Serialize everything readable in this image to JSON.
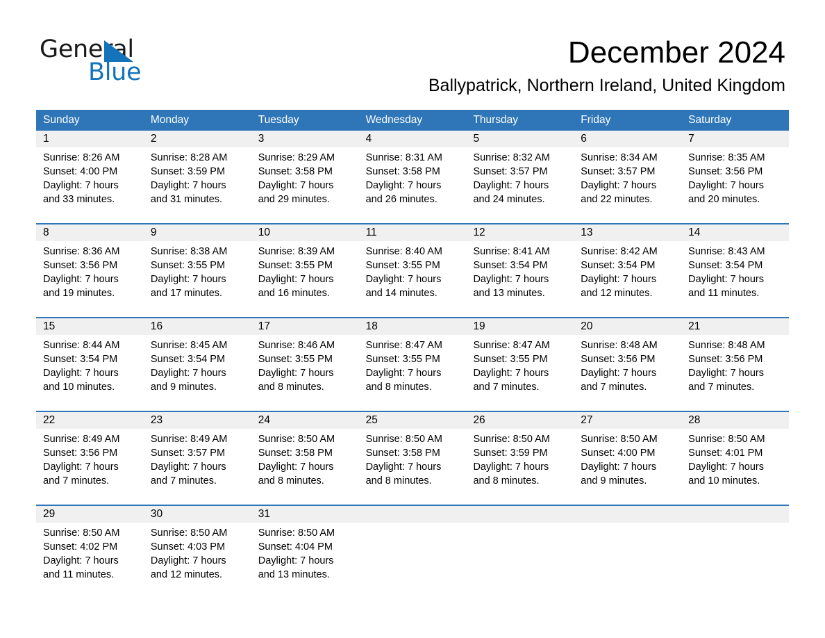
{
  "brand": {
    "name_part1": "General",
    "name_part2": "Blue",
    "triangle_color": "#1373bb"
  },
  "header": {
    "month_title": "December 2024",
    "location": "Ballypatrick, Northern Ireland, United Kingdom"
  },
  "colors": {
    "header_blue": "#2e76b8",
    "day_band_gray": "#f0f0f0",
    "text": "#000000",
    "header_text": "#ffffff"
  },
  "calendar": {
    "weekdays": [
      "Sunday",
      "Monday",
      "Tuesday",
      "Wednesday",
      "Thursday",
      "Friday",
      "Saturday"
    ],
    "weeks": [
      [
        {
          "day": "1",
          "sunrise": "Sunrise: 8:26 AM",
          "sunset": "Sunset: 4:00 PM",
          "daylight1": "Daylight: 7 hours",
          "daylight2": "and 33 minutes."
        },
        {
          "day": "2",
          "sunrise": "Sunrise: 8:28 AM",
          "sunset": "Sunset: 3:59 PM",
          "daylight1": "Daylight: 7 hours",
          "daylight2": "and 31 minutes."
        },
        {
          "day": "3",
          "sunrise": "Sunrise: 8:29 AM",
          "sunset": "Sunset: 3:58 PM",
          "daylight1": "Daylight: 7 hours",
          "daylight2": "and 29 minutes."
        },
        {
          "day": "4",
          "sunrise": "Sunrise: 8:31 AM",
          "sunset": "Sunset: 3:58 PM",
          "daylight1": "Daylight: 7 hours",
          "daylight2": "and 26 minutes."
        },
        {
          "day": "5",
          "sunrise": "Sunrise: 8:32 AM",
          "sunset": "Sunset: 3:57 PM",
          "daylight1": "Daylight: 7 hours",
          "daylight2": "and 24 minutes."
        },
        {
          "day": "6",
          "sunrise": "Sunrise: 8:34 AM",
          "sunset": "Sunset: 3:57 PM",
          "daylight1": "Daylight: 7 hours",
          "daylight2": "and 22 minutes."
        },
        {
          "day": "7",
          "sunrise": "Sunrise: 8:35 AM",
          "sunset": "Sunset: 3:56 PM",
          "daylight1": "Daylight: 7 hours",
          "daylight2": "and 20 minutes."
        }
      ],
      [
        {
          "day": "8",
          "sunrise": "Sunrise: 8:36 AM",
          "sunset": "Sunset: 3:56 PM",
          "daylight1": "Daylight: 7 hours",
          "daylight2": "and 19 minutes."
        },
        {
          "day": "9",
          "sunrise": "Sunrise: 8:38 AM",
          "sunset": "Sunset: 3:55 PM",
          "daylight1": "Daylight: 7 hours",
          "daylight2": "and 17 minutes."
        },
        {
          "day": "10",
          "sunrise": "Sunrise: 8:39 AM",
          "sunset": "Sunset: 3:55 PM",
          "daylight1": "Daylight: 7 hours",
          "daylight2": "and 16 minutes."
        },
        {
          "day": "11",
          "sunrise": "Sunrise: 8:40 AM",
          "sunset": "Sunset: 3:55 PM",
          "daylight1": "Daylight: 7 hours",
          "daylight2": "and 14 minutes."
        },
        {
          "day": "12",
          "sunrise": "Sunrise: 8:41 AM",
          "sunset": "Sunset: 3:54 PM",
          "daylight1": "Daylight: 7 hours",
          "daylight2": "and 13 minutes."
        },
        {
          "day": "13",
          "sunrise": "Sunrise: 8:42 AM",
          "sunset": "Sunset: 3:54 PM",
          "daylight1": "Daylight: 7 hours",
          "daylight2": "and 12 minutes."
        },
        {
          "day": "14",
          "sunrise": "Sunrise: 8:43 AM",
          "sunset": "Sunset: 3:54 PM",
          "daylight1": "Daylight: 7 hours",
          "daylight2": "and 11 minutes."
        }
      ],
      [
        {
          "day": "15",
          "sunrise": "Sunrise: 8:44 AM",
          "sunset": "Sunset: 3:54 PM",
          "daylight1": "Daylight: 7 hours",
          "daylight2": "and 10 minutes."
        },
        {
          "day": "16",
          "sunrise": "Sunrise: 8:45 AM",
          "sunset": "Sunset: 3:54 PM",
          "daylight1": "Daylight: 7 hours",
          "daylight2": "and 9 minutes."
        },
        {
          "day": "17",
          "sunrise": "Sunrise: 8:46 AM",
          "sunset": "Sunset: 3:55 PM",
          "daylight1": "Daylight: 7 hours",
          "daylight2": "and 8 minutes."
        },
        {
          "day": "18",
          "sunrise": "Sunrise: 8:47 AM",
          "sunset": "Sunset: 3:55 PM",
          "daylight1": "Daylight: 7 hours",
          "daylight2": "and 8 minutes."
        },
        {
          "day": "19",
          "sunrise": "Sunrise: 8:47 AM",
          "sunset": "Sunset: 3:55 PM",
          "daylight1": "Daylight: 7 hours",
          "daylight2": "and 7 minutes."
        },
        {
          "day": "20",
          "sunrise": "Sunrise: 8:48 AM",
          "sunset": "Sunset: 3:56 PM",
          "daylight1": "Daylight: 7 hours",
          "daylight2": "and 7 minutes."
        },
        {
          "day": "21",
          "sunrise": "Sunrise: 8:48 AM",
          "sunset": "Sunset: 3:56 PM",
          "daylight1": "Daylight: 7 hours",
          "daylight2": "and 7 minutes."
        }
      ],
      [
        {
          "day": "22",
          "sunrise": "Sunrise: 8:49 AM",
          "sunset": "Sunset: 3:56 PM",
          "daylight1": "Daylight: 7 hours",
          "daylight2": "and 7 minutes."
        },
        {
          "day": "23",
          "sunrise": "Sunrise: 8:49 AM",
          "sunset": "Sunset: 3:57 PM",
          "daylight1": "Daylight: 7 hours",
          "daylight2": "and 7 minutes."
        },
        {
          "day": "24",
          "sunrise": "Sunrise: 8:50 AM",
          "sunset": "Sunset: 3:58 PM",
          "daylight1": "Daylight: 7 hours",
          "daylight2": "and 8 minutes."
        },
        {
          "day": "25",
          "sunrise": "Sunrise: 8:50 AM",
          "sunset": "Sunset: 3:58 PM",
          "daylight1": "Daylight: 7 hours",
          "daylight2": "and 8 minutes."
        },
        {
          "day": "26",
          "sunrise": "Sunrise: 8:50 AM",
          "sunset": "Sunset: 3:59 PM",
          "daylight1": "Daylight: 7 hours",
          "daylight2": "and 8 minutes."
        },
        {
          "day": "27",
          "sunrise": "Sunrise: 8:50 AM",
          "sunset": "Sunset: 4:00 PM",
          "daylight1": "Daylight: 7 hours",
          "daylight2": "and 9 minutes."
        },
        {
          "day": "28",
          "sunrise": "Sunrise: 8:50 AM",
          "sunset": "Sunset: 4:01 PM",
          "daylight1": "Daylight: 7 hours",
          "daylight2": "and 10 minutes."
        }
      ],
      [
        {
          "day": "29",
          "sunrise": "Sunrise: 8:50 AM",
          "sunset": "Sunset: 4:02 PM",
          "daylight1": "Daylight: 7 hours",
          "daylight2": "and 11 minutes."
        },
        {
          "day": "30",
          "sunrise": "Sunrise: 8:50 AM",
          "sunset": "Sunset: 4:03 PM",
          "daylight1": "Daylight: 7 hours",
          "daylight2": "and 12 minutes."
        },
        {
          "day": "31",
          "sunrise": "Sunrise: 8:50 AM",
          "sunset": "Sunset: 4:04 PM",
          "daylight1": "Daylight: 7 hours",
          "daylight2": "and 13 minutes."
        },
        {
          "day": "",
          "sunrise": "",
          "sunset": "",
          "daylight1": "",
          "daylight2": ""
        },
        {
          "day": "",
          "sunrise": "",
          "sunset": "",
          "daylight1": "",
          "daylight2": ""
        },
        {
          "day": "",
          "sunrise": "",
          "sunset": "",
          "daylight1": "",
          "daylight2": ""
        },
        {
          "day": "",
          "sunrise": "",
          "sunset": "",
          "daylight1": "",
          "daylight2": ""
        }
      ]
    ]
  }
}
